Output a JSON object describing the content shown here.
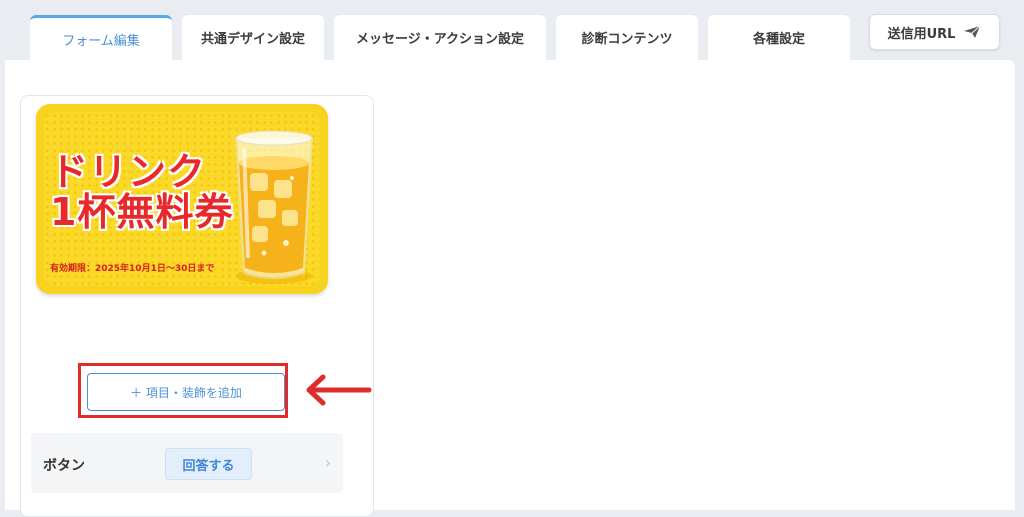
{
  "tabs": [
    {
      "label": "フォーム編集",
      "active": true
    },
    {
      "label": "共通デザイン設定"
    },
    {
      "label": "メッセージ・アクション設定"
    },
    {
      "label": "診断コンテンツ"
    },
    {
      "label": "各種設定"
    }
  ],
  "send_url": {
    "label": "送信用URL",
    "icon": "paper-plane-icon"
  },
  "coupon": {
    "title_line1": "ドリンク",
    "title_line2": "1杯無料券",
    "validity": "有効期限：2025年10月1日〜30日まで",
    "icon": "drink-glass-icon"
  },
  "add_item": {
    "label": "＋ 項目・装飾を追加"
  },
  "button_row": {
    "label": "ボタン",
    "value": "回答する",
    "icon": "chevron-right-icon"
  },
  "colors": {
    "accent": "#4a90d9",
    "highlight_red": "#e02b2b",
    "coupon_yellow": "#f7d21e"
  }
}
